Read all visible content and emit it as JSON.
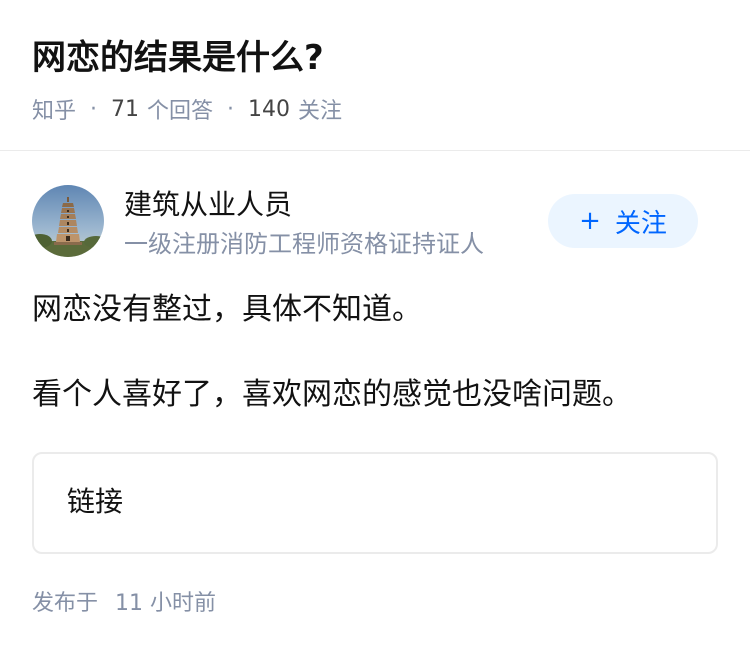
{
  "question": {
    "title": "网恋的结果是什么?",
    "source": "知乎",
    "answer_count": "71",
    "answer_label": "个回答",
    "follower_count": "140",
    "follower_label": "关注",
    "separator": "·"
  },
  "answer": {
    "author": {
      "avatar_icon": "pagoda-avatar-icon",
      "name": "建筑从业人员",
      "headline": "一级注册消防工程师资格证持证人"
    },
    "follow_button": {
      "icon": "plus-icon",
      "plus_symbol": "+",
      "label": "关注"
    },
    "paragraphs": [
      "网恋没有整过，具体不知道。",
      "看个人喜好了，喜欢网恋的感觉也没啥问题。"
    ],
    "link_card": {
      "label": "链接"
    },
    "publish": {
      "label": "发布于",
      "time": "11 小时前"
    }
  },
  "colors": {
    "primary_text": "#121212",
    "secondary_text": "#8590a6",
    "accent_blue": "#0066ff",
    "follow_bg": "#ebf5ff",
    "border": "#ebebeb"
  }
}
